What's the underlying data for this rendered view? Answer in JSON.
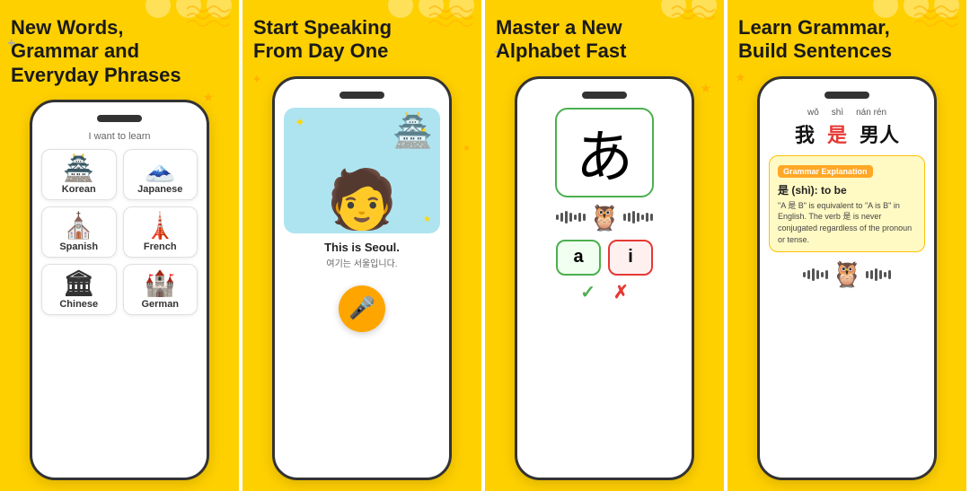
{
  "panels": [
    {
      "id": "panel1",
      "title": "New Words,\nGrammar and\nEveryday Phrases",
      "subtitle": "I want to learn",
      "languages": [
        {
          "name": "Korean",
          "icon": "🏯"
        },
        {
          "name": "Japanese",
          "icon": "🗻"
        },
        {
          "name": "Spanish",
          "icon": "⛪"
        },
        {
          "name": "French",
          "icon": "🗼"
        },
        {
          "name": "Chinese",
          "icon": "🏛"
        },
        {
          "name": "German",
          "icon": "🏰"
        }
      ]
    },
    {
      "id": "panel2",
      "title": "Start Speaking\nFrom Day One",
      "speech_text": "This is Seoul.",
      "speech_subtext": "여기는 서울입니다.",
      "mic_icon": "🎤"
    },
    {
      "id": "panel3",
      "title": "Master a New\nAlphabet Fast",
      "char": "あ",
      "answer_a": "a",
      "answer_i": "i"
    },
    {
      "id": "panel4",
      "title": "Learn Grammar,\nBuild Sentences",
      "pinyin": [
        "wǒ",
        "shì",
        "nán rén"
      ],
      "hanzi": [
        "我",
        "是",
        "男人"
      ],
      "grammar_title": "Grammar Explanation",
      "grammar_term": "是 (shì): to be",
      "grammar_desc": "\"A 是 B\" is equivalent to \"A is B\" in English. The verb 是 is never conjugated regardless of the pronoun or tense."
    }
  ]
}
